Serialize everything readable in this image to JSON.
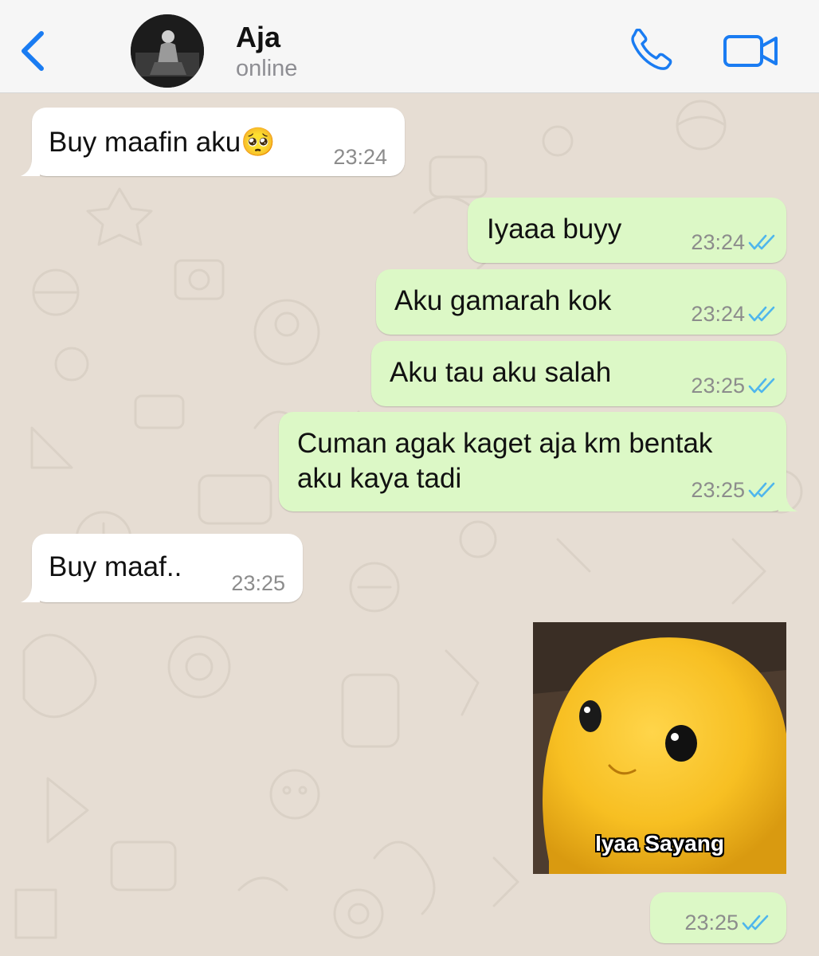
{
  "header": {
    "contact_name": "Aja",
    "status": "online",
    "back_icon": "chevron-left-icon",
    "call_icon": "phone-icon",
    "video_icon": "video-camera-icon",
    "accent_color": "#1a7cf2"
  },
  "messages": [
    {
      "direction": "incoming",
      "text": "Buy maafin aku",
      "emoji": "🥺",
      "time": "23:24"
    },
    {
      "direction": "outgoing",
      "text": "Iyaaa buyy",
      "time": "23:24",
      "read": true
    },
    {
      "direction": "outgoing",
      "text": "Aku gamarah kok",
      "time": "23:24",
      "read": true
    },
    {
      "direction": "outgoing",
      "text": "Aku tau aku salah",
      "time": "23:25",
      "read": true
    },
    {
      "direction": "outgoing",
      "text_line1": "Cuman agak kaget aja km bentak",
      "text_line2": "aku kaya tadi",
      "time": "23:25",
      "read": true
    },
    {
      "direction": "incoming",
      "text": "Buy maaf..",
      "time": "23:25"
    },
    {
      "direction": "outgoing",
      "sticker_caption": "Iyaa Sayang",
      "time": "23:25",
      "read": true
    }
  ],
  "colors": {
    "incoming_bubble": "#ffffff",
    "outgoing_bubble": "#dcf8c6",
    "read_ticks": "#4fb6ec",
    "chat_background": "#e6ddd3"
  }
}
